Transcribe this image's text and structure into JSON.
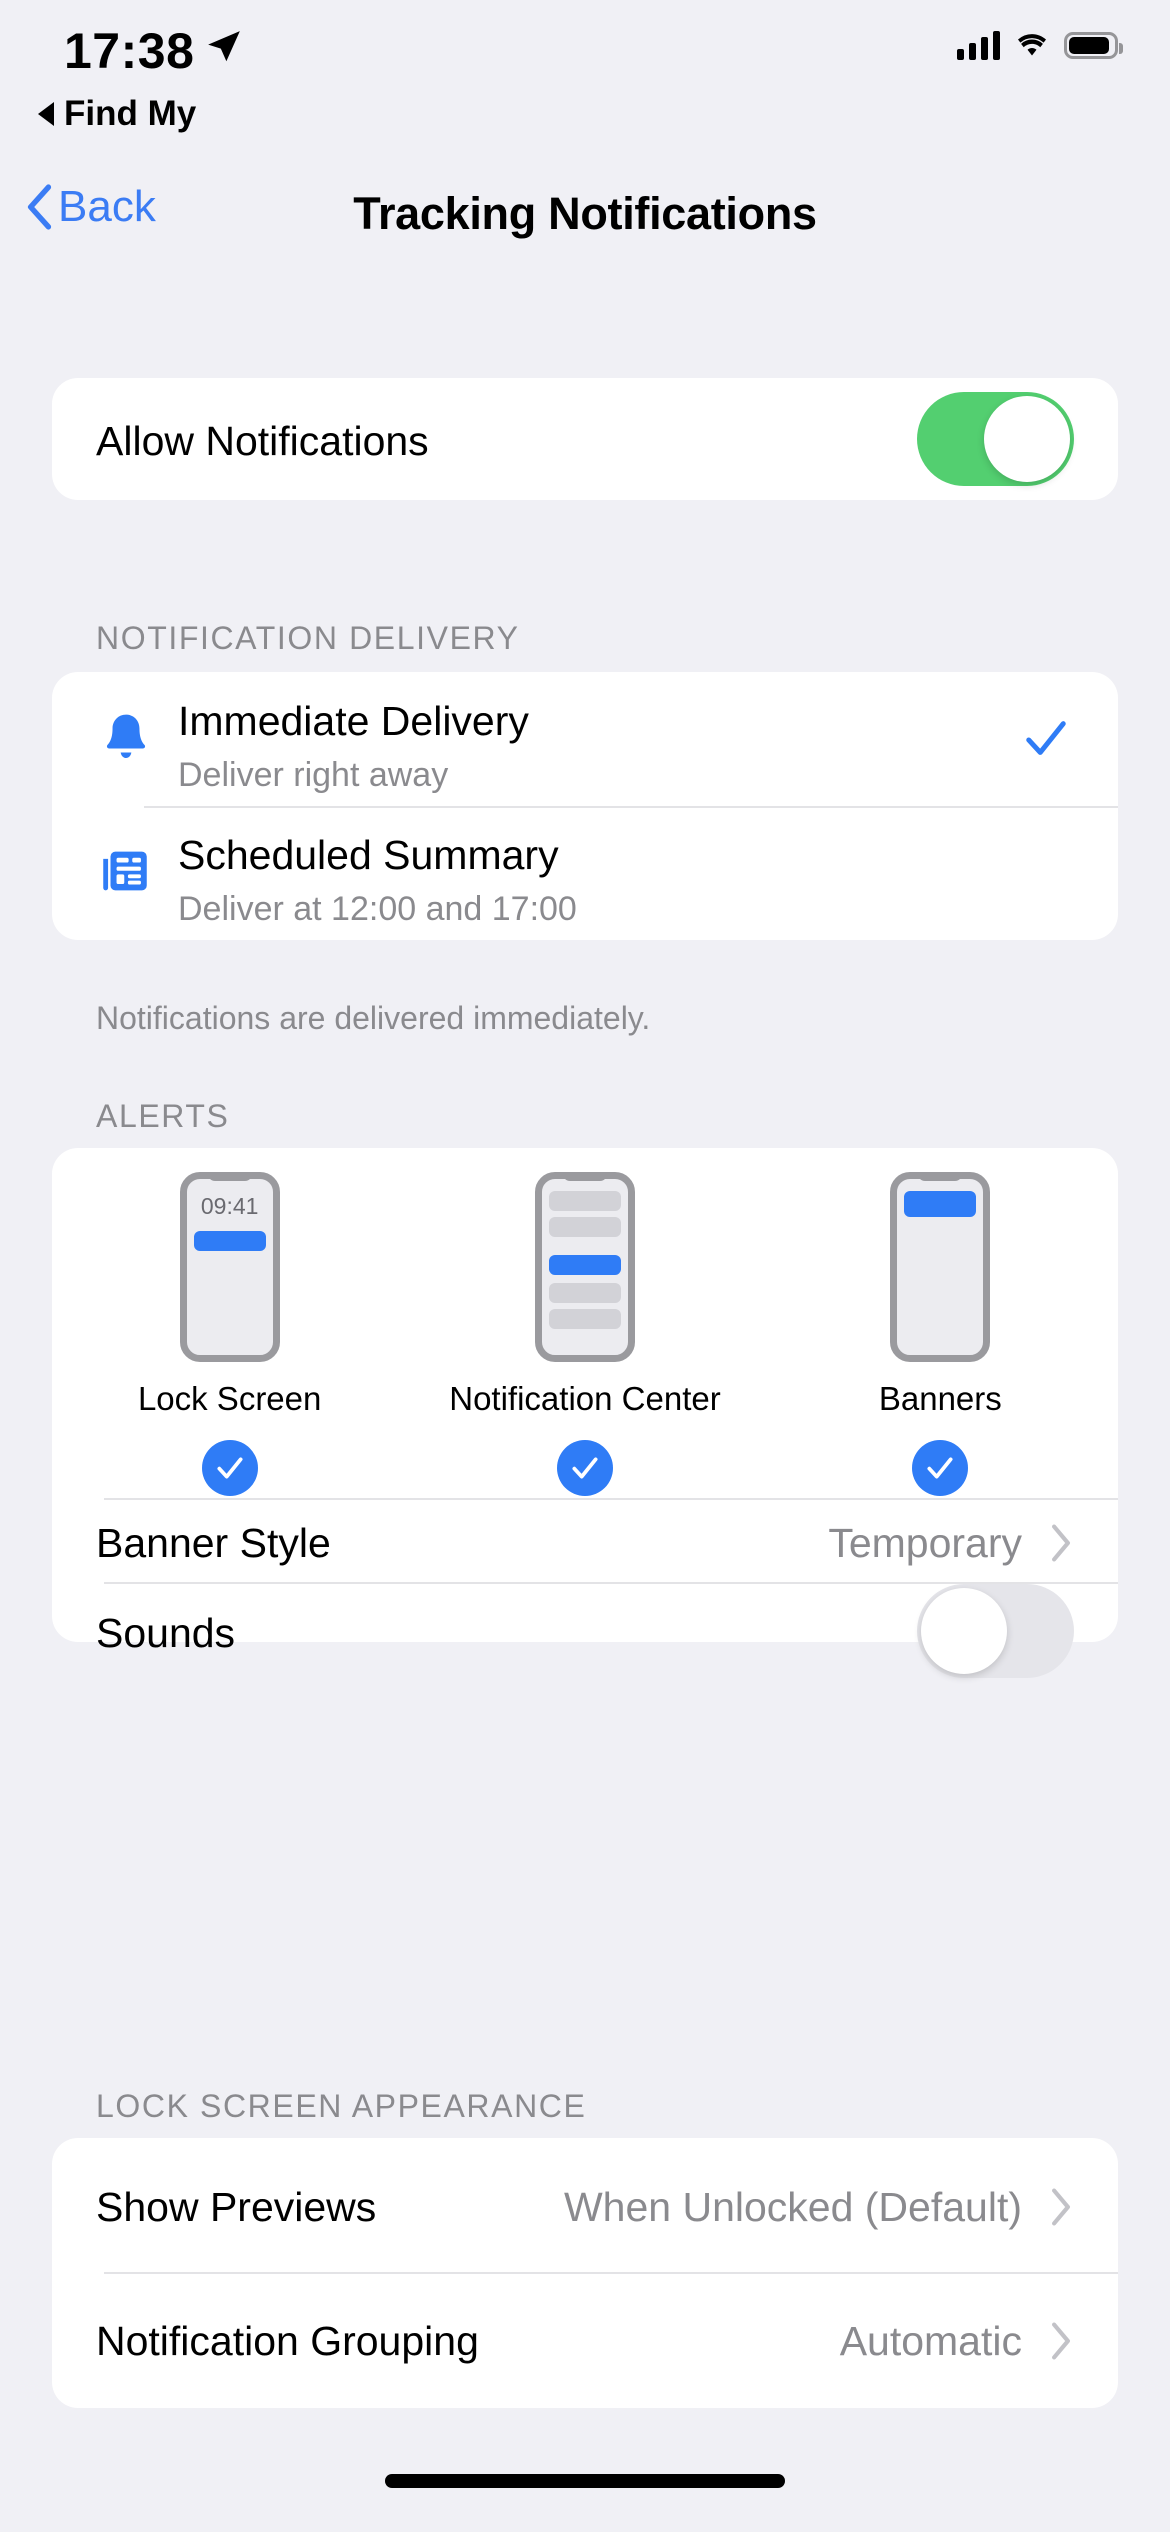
{
  "status_bar": {
    "time": "17:38",
    "location_icon": "location-arrow-icon",
    "cellular_icon": "cellular-bars-icon",
    "wifi_icon": "wifi-icon",
    "battery_icon": "battery-icon"
  },
  "back_to_app": {
    "label": "Find My",
    "icon": "back-triangle-icon"
  },
  "nav": {
    "back_label": "Back",
    "back_icon": "chevron-left-icon",
    "title": "Tracking Notifications"
  },
  "allow_notifications": {
    "label": "Allow Notifications",
    "toggle_state": "on",
    "toggle_on_color": "#53cf70"
  },
  "notification_delivery": {
    "header": "NOTIFICATION DELIVERY",
    "footer": "Notifications are delivered immediately.",
    "options": [
      {
        "icon": "bell-icon",
        "title": "Immediate Delivery",
        "subtitle": "Deliver right away",
        "selected": true,
        "check_icon": "checkmark-icon"
      },
      {
        "icon": "newspaper-icon",
        "title": "Scheduled Summary",
        "subtitle": "Deliver at 12:00 and 17:00",
        "selected": false,
        "check_icon": "checkmark-icon"
      }
    ]
  },
  "alerts": {
    "header": "ALERTS",
    "styles": [
      {
        "label": "Lock Screen",
        "mockup": "lock-screen-preview",
        "time": "09:41",
        "checked": true
      },
      {
        "label": "Notification Center",
        "mockup": "notification-center-preview",
        "checked": true
      },
      {
        "label": "Banners",
        "mockup": "banners-preview",
        "checked": true
      }
    ],
    "banner_style": {
      "label": "Banner Style",
      "value": "Temporary",
      "chevron": "chevron-right-icon"
    },
    "sounds": {
      "label": "Sounds",
      "toggle_state": "off"
    }
  },
  "lock_screen_appearance": {
    "header": "LOCK SCREEN APPEARANCE",
    "rows": [
      {
        "label": "Show Previews",
        "value": "When Unlocked (Default)",
        "chevron": "chevron-right-icon"
      },
      {
        "label": "Notification Grouping",
        "value": "Automatic",
        "chevron": "chevron-right-icon"
      }
    ]
  },
  "colors": {
    "accent_blue": "#3b7cf4",
    "toggle_green": "#53cf70",
    "background": "#f0f0f5",
    "card": "#ffffff",
    "secondary_text": "#8a8a8e"
  }
}
